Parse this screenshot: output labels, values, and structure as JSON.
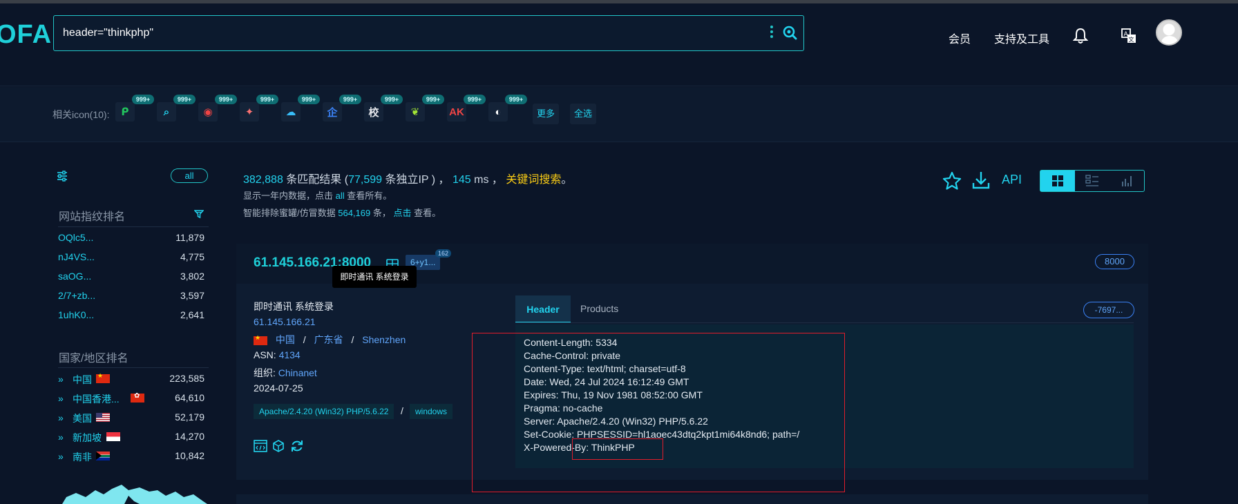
{
  "header": {
    "logo": "OFA",
    "search_value": "header=\"thinkphp\"",
    "nav_member": "会员",
    "nav_tools": "支持及工具"
  },
  "icon_bar": {
    "label": "相关icon(10):",
    "badge": "999+",
    "icons": [
      {
        "name": "icon-p",
        "glyph": "ᑭ",
        "color": "#22c55e"
      },
      {
        "name": "icon-search-teal",
        "glyph": "⌕",
        "color": "#22d3ee"
      },
      {
        "name": "icon-red-swirl",
        "glyph": "◉",
        "color": "#ef4444"
      },
      {
        "name": "icon-red-bird",
        "glyph": "✦",
        "color": "#f87171"
      },
      {
        "name": "icon-cloud",
        "glyph": "☁",
        "color": "#38bdf8"
      },
      {
        "name": "icon-qi",
        "glyph": "企",
        "color": "#3b82f6"
      },
      {
        "name": "icon-xiao",
        "glyph": "校",
        "color": "#e5e7eb"
      },
      {
        "name": "icon-leaf",
        "glyph": "❦",
        "color": "#a3e635"
      },
      {
        "name": "icon-ak",
        "glyph": "AK",
        "color": "#ef4444"
      },
      {
        "name": "icon-circle-logo",
        "glyph": "◐",
        "color": "#ffffff"
      }
    ],
    "more": "更多",
    "select_all": "全选"
  },
  "sidebar": {
    "all": "all",
    "fingerprint_title": "网站指纹排名",
    "fingerprints": [
      {
        "name": "OQlc5...",
        "count": "11,879"
      },
      {
        "name": "nJ4VS...",
        "count": "4,775"
      },
      {
        "name": "saOG...",
        "count": "3,802"
      },
      {
        "name": "2/7+zb...",
        "count": "3,597"
      },
      {
        "name": "1uhK0...",
        "count": "2,641"
      }
    ],
    "country_title": "国家/地区排名",
    "countries": [
      {
        "name": "中国",
        "flag": "cn",
        "count": "223,585"
      },
      {
        "name": "中国香港...",
        "flag": "hk",
        "count": "64,610"
      },
      {
        "name": "美国",
        "flag": "us",
        "count": "52,179"
      },
      {
        "name": "新加坡",
        "flag": "sg",
        "count": "14,270"
      },
      {
        "name": "南非",
        "flag": "za",
        "count": "10,842"
      }
    ]
  },
  "results": {
    "count": "382,888",
    "count_suffix": " 条匹配结果 (",
    "ip_count": "77,599",
    "ip_suffix": " 条独立IP ) ， ",
    "ms": "145",
    "ms_suffix": " ms ， ",
    "keyword": "关键词搜索",
    "end": "。",
    "sub1_pre": "显示一年内数据，点击 ",
    "sub1_link": "all",
    "sub1_post": " 查看所有。",
    "sub2_pre": "智能排除蜜罐/仿冒数据 ",
    "sub2_num": "564,169",
    "sub2_mid": " 条， ",
    "sub2_link": "点击",
    "sub2_post": " 查看。",
    "api": "API"
  },
  "card": {
    "host": "61.145.166.21:8000",
    "badge": "6+y1...",
    "badge_sup": "162",
    "tooltip": "即时通讯 系统登录",
    "port": "8000",
    "title": "即时通讯 系统登录",
    "ip": "61.145.166.21",
    "country": "中国",
    "province": "广东省",
    "city": "Shenzhen",
    "asn_label": "ASN: ",
    "asn": "4134",
    "org_label": "组织: ",
    "org": "Chinanet",
    "date": "2024-07-25",
    "tag_server": "Apache/2.4.20 (Win32) PHP/5.6.22",
    "tag_os": "windows",
    "tab_header": "Header",
    "tab_products": "Products",
    "hash": "-7697...",
    "header_lines": [
      "Content-Length: 5334",
      "Cache-Control: private",
      "Content-Type: text/html; charset=utf-8",
      "Date: Wed, 24 Jul 2024 16:12:49 GMT",
      "Expires: Thu, 19 Nov 1981 08:52:00 GMT",
      "Pragma: no-cache",
      "Server: Apache/2.4.20 (Win32) PHP/5.6.22",
      "Set-Cookie: PHPSESSID=hl1aoec43dtq2kpt1mi64k8nd6; path=/",
      "X-Powered-By: ThinkPHP"
    ]
  },
  "colors": {
    "accent": "#22d3ee",
    "background": "#0b1528",
    "highlight": "#e11d2b"
  }
}
